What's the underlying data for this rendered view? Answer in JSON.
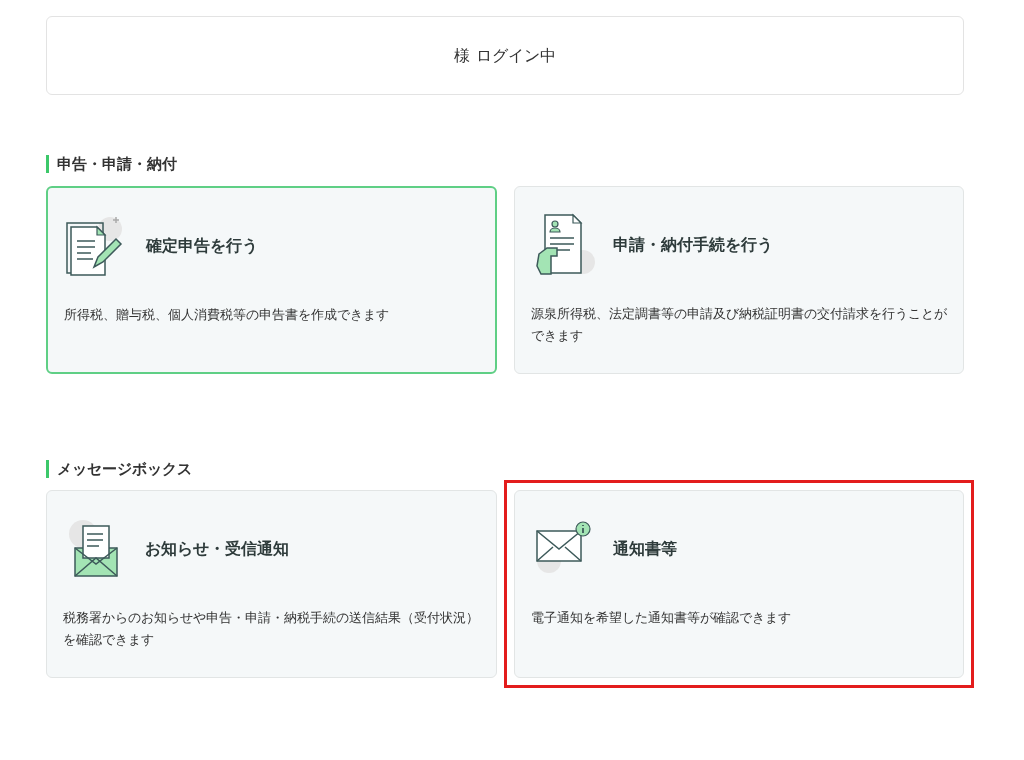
{
  "login_status": "様 ログイン中",
  "sections": [
    {
      "title": "申告・申請・納付",
      "cards": [
        {
          "kind": "tax-return",
          "title": "確定申告を行う",
          "description": "所得税、贈与税、個人消費税等の申告書を作成できます",
          "selected": true,
          "highlighted": false
        },
        {
          "kind": "application",
          "title": "申請・納付手続を行う",
          "description": "源泉所得税、法定調書等の申請及び納税証明書の交付請求を行うことができます",
          "selected": false,
          "highlighted": false
        }
      ]
    },
    {
      "title": "メッセージボックス",
      "cards": [
        {
          "kind": "notice",
          "title": "お知らせ・受信通知",
          "description": "税務署からのお知らせや申告・申請・納税手続の送信結果（受付状況）を確認できます",
          "selected": false,
          "highlighted": false
        },
        {
          "kind": "mail",
          "title": "通知書等",
          "description": "電子通知を希望した通知書等が確認できます",
          "selected": false,
          "highlighted": true
        }
      ]
    }
  ]
}
